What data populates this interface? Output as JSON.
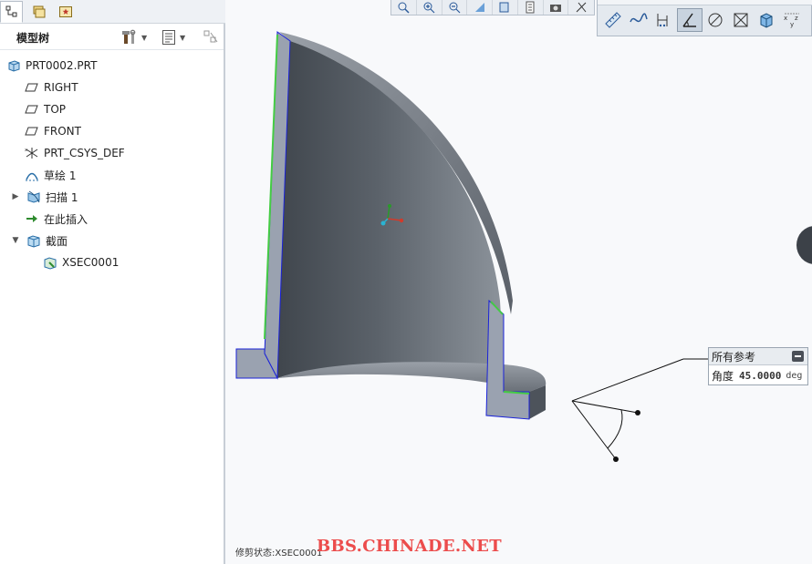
{
  "model_tree": {
    "title": "模型树",
    "items": [
      {
        "label": "PRT0002.PRT",
        "icon": "part-icon"
      },
      {
        "label": "RIGHT",
        "icon": "datum-plane-icon"
      },
      {
        "label": "TOP",
        "icon": "datum-plane-icon"
      },
      {
        "label": "FRONT",
        "icon": "datum-plane-icon"
      },
      {
        "label": "PRT_CSYS_DEF",
        "icon": "coordinate-system-icon"
      },
      {
        "label": "草绘 1",
        "icon": "sketch-icon"
      },
      {
        "label": "扫描 1",
        "icon": "sweep-icon",
        "expandable": true
      },
      {
        "label": "在此插入",
        "icon": "insert-here-arrow-icon"
      },
      {
        "label": "截面",
        "icon": "section-folder-icon",
        "expanded": true
      },
      {
        "label": "XSEC0001",
        "icon": "xsection-icon"
      }
    ]
  },
  "reference_popup": {
    "title": "所有参考",
    "angle_label": "角度",
    "angle_value": "45.0000",
    "angle_unit": "deg"
  },
  "status": {
    "text": "修剪状态:XSEC0001"
  },
  "watermark": "BBS.CHINADE.NET",
  "colors": {
    "model_face_light": "#8e949b",
    "model_face_dark": "#3f454c",
    "cut_face": "#9aa0ab",
    "edge_blue": "#1a22d8",
    "edge_green": "#44cc44",
    "watermark_red": "#ec4c4c",
    "background": "#f8f9fb"
  }
}
